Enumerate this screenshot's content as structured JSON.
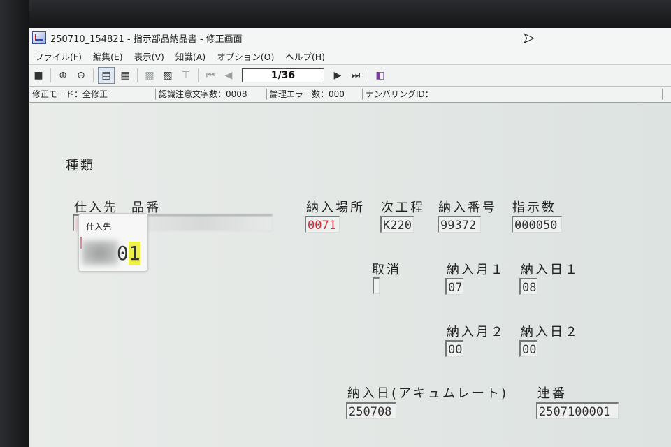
{
  "window": {
    "title": "250710_154821 - 指示部品納品書 - 修正画面"
  },
  "menu": {
    "items": [
      "ファイル(F)",
      "編集(E)",
      "表示(V)",
      "知識(A)",
      "オプション(O)",
      "ヘルプ(H)"
    ]
  },
  "toolbar": {
    "page_indicator": "1/36"
  },
  "status": {
    "mode": "修正モード：全修正",
    "recognition_caution": "認識注意文字数：0008",
    "logic_errors": "論理エラー数：000",
    "numbering_id": "ナンバリングID："
  },
  "form": {
    "kind_label": "種類",
    "supplier_label": "仕入先",
    "part_no_label": "品番",
    "supplier_value_tail": "1",
    "delivery_place_label": "納入場所",
    "delivery_place_value": "0071",
    "next_process_label": "次工程",
    "next_process_value": "K220",
    "delivery_no_label": "納入番号",
    "delivery_no_value": "99372",
    "instruction_qty_label": "指示数",
    "instruction_qty_value": "000050",
    "cancel_label": "取消",
    "delivery_month1_label": "納入月１",
    "delivery_month1_value": "07",
    "delivery_day1_label": "納入日１",
    "delivery_day1_value": "08",
    "delivery_month2_label": "納入月２",
    "delivery_month2_value": "00",
    "delivery_day2_label": "納入日２",
    "delivery_day2_value": "00",
    "accumulate_date_label": "納入日(アキュムレート)",
    "accumulate_date_value": "250708",
    "serial_label": "連番",
    "serial_value": "2507100001"
  },
  "tooltip": {
    "title": "仕入先",
    "value_plain": "0",
    "value_highlight": "1"
  }
}
